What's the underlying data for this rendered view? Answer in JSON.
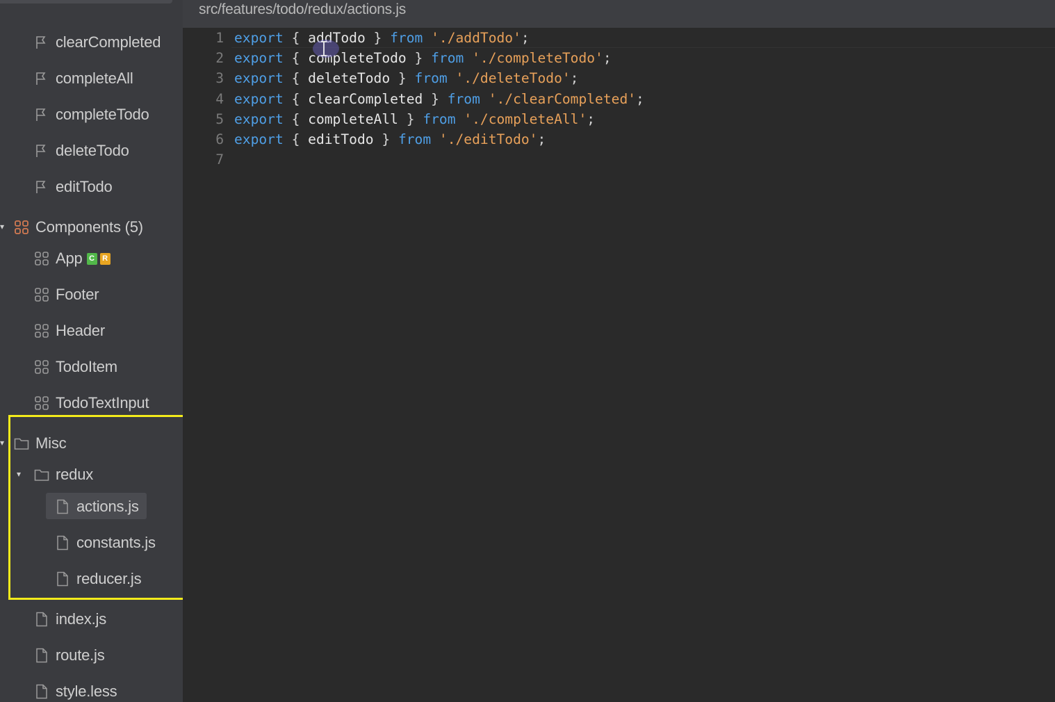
{
  "sidebar": {
    "actions": [
      "clearCompleted",
      "completeAll",
      "completeTodo",
      "deleteTodo",
      "editTodo"
    ],
    "components_label": "Components (5)",
    "components": [
      "App",
      "Footer",
      "Header",
      "TodoItem",
      "TodoTextInput"
    ],
    "app_badges": [
      "C",
      "R"
    ],
    "misc_label": "Misc",
    "redux_label": "redux",
    "redux_files": [
      "actions.js",
      "constants.js",
      "reducer.js"
    ],
    "other_files": [
      "index.js",
      "route.js",
      "style.less"
    ],
    "selected_file": "actions.js"
  },
  "editor": {
    "path": "src/features/todo/redux/actions.js",
    "lines": [
      {
        "n": "1",
        "kw": "export",
        "open": " { ",
        "id": "addTodo",
        "close": " } ",
        "from": "from",
        "src": "'./addTodo'",
        "end": ";"
      },
      {
        "n": "2",
        "kw": "export",
        "open": " { ",
        "id": "completeTodo",
        "close": " } ",
        "from": "from",
        "src": "'./completeTodo'",
        "end": ";"
      },
      {
        "n": "3",
        "kw": "export",
        "open": " { ",
        "id": "deleteTodo",
        "close": " } ",
        "from": "from",
        "src": "'./deleteTodo'",
        "end": ";"
      },
      {
        "n": "4",
        "kw": "export",
        "open": " { ",
        "id": "clearCompleted",
        "close": " } ",
        "from": "from",
        "src": "'./clearCompleted'",
        "end": ";"
      },
      {
        "n": "5",
        "kw": "export",
        "open": " { ",
        "id": "completeAll",
        "close": " } ",
        "from": "from",
        "src": "'./completeAll'",
        "end": ";"
      },
      {
        "n": "6",
        "kw": "export",
        "open": " { ",
        "id": "editTodo",
        "close": " } ",
        "from": "from",
        "src": "'./editTodo'",
        "end": ";"
      },
      {
        "n": "7",
        "kw": "",
        "open": "",
        "id": "",
        "close": "",
        "from": "",
        "src": "",
        "end": ""
      }
    ]
  },
  "icons": {
    "action": "flag-icon",
    "component": "component-grid-icon",
    "folder": "folder-icon",
    "file": "file-icon",
    "caret": "caret-down-icon"
  },
  "colors": {
    "highlight": "#f3eb1b",
    "keyword": "#4f9fe6",
    "string": "#e8a15a",
    "badge_c": "#52b84a",
    "badge_r": "#e8a521",
    "components_icon": "#d27a52"
  }
}
